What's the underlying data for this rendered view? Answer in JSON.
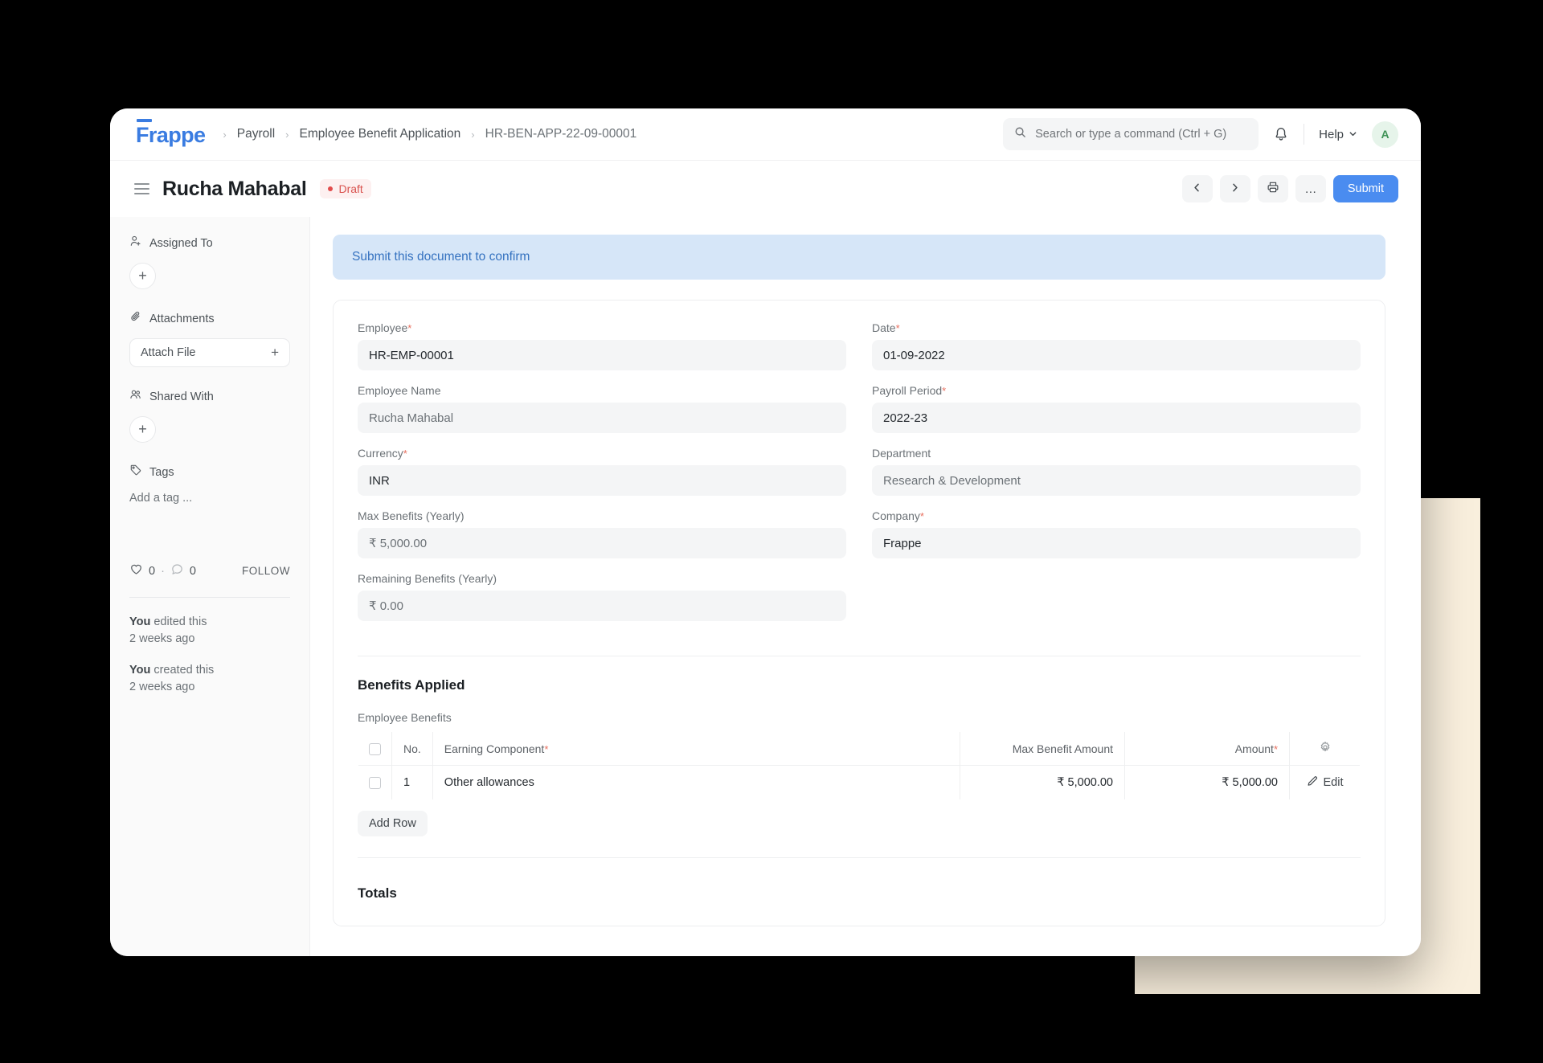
{
  "navbar": {
    "brand": "Frappe",
    "breadcrumbs": [
      {
        "label": "Payroll"
      },
      {
        "label": "Employee Benefit Application"
      },
      {
        "label": "HR-BEN-APP-22-09-00001"
      }
    ],
    "separator": "›",
    "search": {
      "placeholder": "Search or type a command (Ctrl + G)",
      "value": "",
      "icon": "search-icon"
    },
    "notifications_icon": "bell-icon",
    "help": {
      "label": "Help",
      "icon": "chevron-down-icon"
    },
    "avatar": {
      "initial": "A",
      "bg": "#e6f4ea",
      "color": "#3f9256"
    }
  },
  "page_header": {
    "menu_icon": "hamburger-icon",
    "title": "Rucha Mahabal",
    "status": {
      "label": "Draft",
      "color": "#d9534f",
      "bg": "#fdf0f0"
    },
    "actions": {
      "prev": "‹",
      "next": "›",
      "print_icon": "printer-icon",
      "more": "…",
      "submit_label": "Submit",
      "submit_color": "#4a8cf0"
    }
  },
  "sidebar": {
    "assigned_to": {
      "label": "Assigned To",
      "icon": "user-add-icon",
      "add_label": "+"
    },
    "attachments": {
      "label": "Attachments",
      "icon": "paperclip-icon",
      "attach_label": "Attach File",
      "add_label": "+"
    },
    "shared_with": {
      "label": "Shared With",
      "icon": "users-icon",
      "add_label": "+"
    },
    "tags": {
      "label": "Tags",
      "icon": "tag-icon",
      "placeholder": "Add a tag ..."
    },
    "social": {
      "like_icon": "heart-icon",
      "like_count": "0",
      "separator": "·",
      "comment_icon": "comment-icon",
      "comment_count": "0",
      "follow_label": "FOLLOW"
    },
    "activity": [
      {
        "actor": "You",
        "action": "edited this",
        "time": "2 weeks ago"
      },
      {
        "actor": "You",
        "action": "created this",
        "time": "2 weeks ago"
      }
    ]
  },
  "alert": {
    "text": "Submit this document to confirm",
    "bg": "#d6e6f8",
    "color": "#3572c0"
  },
  "form": {
    "left": [
      {
        "label": "Employee",
        "required": true,
        "value": "HR-EMP-00001",
        "muted": false
      },
      {
        "label": "Employee Name",
        "required": false,
        "value": "Rucha Mahabal",
        "muted": true
      },
      {
        "label": "Currency",
        "required": true,
        "value": "INR",
        "muted": false
      },
      {
        "label": "Max Benefits (Yearly)",
        "required": false,
        "value": "₹ 5,000.00",
        "muted": true
      },
      {
        "label": "Remaining Benefits (Yearly)",
        "required": false,
        "value": "₹ 0.00",
        "muted": true
      }
    ],
    "right": [
      {
        "label": "Date",
        "required": true,
        "value": "01-09-2022",
        "muted": false
      },
      {
        "label": "Payroll Period",
        "required": true,
        "value": "2022-23",
        "muted": false
      },
      {
        "label": "Department",
        "required": false,
        "value": "Research & Development",
        "muted": true
      },
      {
        "label": "Company",
        "required": true,
        "value": "Frappe",
        "muted": false
      }
    ]
  },
  "benefits": {
    "section_title": "Benefits Applied",
    "table_label": "Employee Benefits",
    "columns": [
      {
        "label": "",
        "type": "checkbox"
      },
      {
        "label": "No.",
        "type": "text"
      },
      {
        "label": "Earning Component",
        "required": true,
        "type": "text"
      },
      {
        "label": "Max Benefit Amount",
        "type": "number"
      },
      {
        "label": "Amount",
        "required": true,
        "type": "number"
      },
      {
        "label": "",
        "type": "gear",
        "icon": "gear-icon"
      }
    ],
    "rows": [
      {
        "no": "1",
        "earning_component": "Other allowances",
        "max_benefit_amount": "₹ 5,000.00",
        "amount": "₹ 5,000.00",
        "action_label": "Edit",
        "action_icon": "pencil-icon"
      }
    ],
    "add_row_label": "Add Row"
  },
  "totals": {
    "title": "Totals"
  }
}
